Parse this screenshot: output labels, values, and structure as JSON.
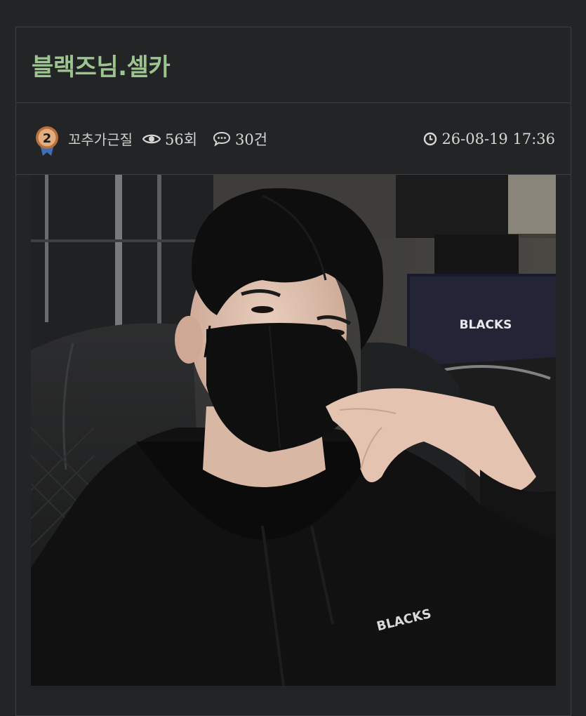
{
  "post": {
    "title": "블랙즈님.셀카",
    "author": {
      "level": "2",
      "name": "꼬추가근질"
    },
    "views": "56회",
    "comments": "30건",
    "date": "26-08-19 17:36"
  },
  "photo": {
    "monitor_text": "BLACKS",
    "hoodie_text": "BLACKS"
  },
  "icons": {
    "views": "eye-icon",
    "comments": "comment-bubble-icon",
    "date": "clock-icon",
    "level": "level-medal-icon"
  }
}
